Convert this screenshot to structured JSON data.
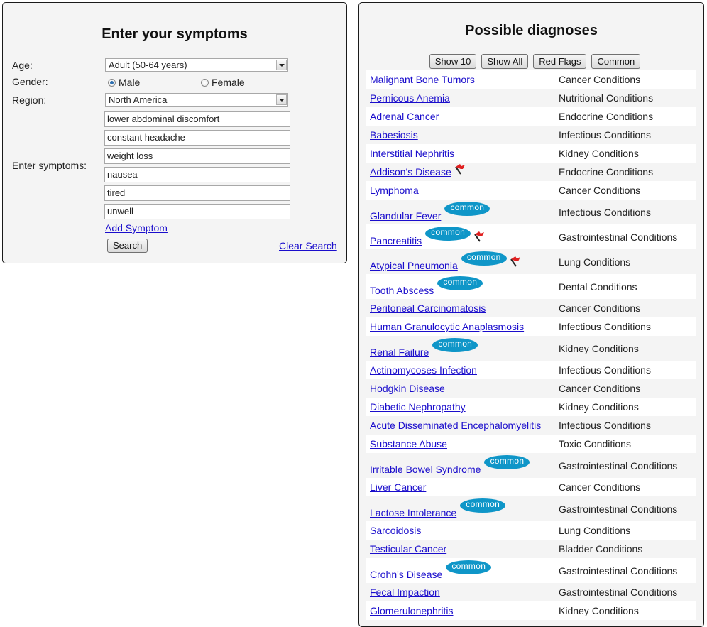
{
  "symptom_form": {
    "title": "Enter your symptoms",
    "age_label": "Age:",
    "age_value": "Adult (50-64 years)",
    "gender_label": "Gender:",
    "gender_options": [
      {
        "label": "Male",
        "selected": true
      },
      {
        "label": "Female",
        "selected": false
      }
    ],
    "region_label": "Region:",
    "region_value": "North America",
    "symptoms_label": "Enter symptoms:",
    "symptoms": [
      "lower abdominal discomfort",
      "constant headache",
      "weight loss",
      "nausea",
      "tired",
      "unwell"
    ],
    "add_symptom_label": "Add Symptom",
    "search_label": "Search",
    "clear_search_label": "Clear Search"
  },
  "diagnoses": {
    "title": "Possible diagnoses",
    "filters": [
      "Show 10",
      "Show All",
      "Red Flags",
      "Common"
    ],
    "badge_text": "common",
    "colors": {
      "link": "#1a0dcc",
      "badge": "#0f96c8",
      "flag": "#e02020"
    },
    "items": [
      {
        "name": "Malignant Bone Tumors",
        "category": "Cancer Conditions",
        "common": false,
        "red_flag": false
      },
      {
        "name": "Pernicous Anemia",
        "category": "Nutritional Conditions",
        "common": false,
        "red_flag": false
      },
      {
        "name": "Adrenal Cancer",
        "category": "Endocrine Conditions",
        "common": false,
        "red_flag": false
      },
      {
        "name": "Babesiosis",
        "category": "Infectious Conditions",
        "common": false,
        "red_flag": false
      },
      {
        "name": "Interstitial Nephritis",
        "category": "Kidney Conditions",
        "common": false,
        "red_flag": false
      },
      {
        "name": "Addison's Disease",
        "category": "Endocrine Conditions",
        "common": false,
        "red_flag": true
      },
      {
        "name": "Lymphoma",
        "category": "Cancer Conditions",
        "common": false,
        "red_flag": false
      },
      {
        "name": "Glandular Fever",
        "category": "Infectious Conditions",
        "common": true,
        "red_flag": false
      },
      {
        "name": "Pancreatitis",
        "category": "Gastrointestinal Conditions",
        "common": true,
        "red_flag": true
      },
      {
        "name": "Atypical Pneumonia",
        "category": "Lung Conditions",
        "common": true,
        "red_flag": true
      },
      {
        "name": "Tooth Abscess",
        "category": "Dental Conditions",
        "common": true,
        "red_flag": false
      },
      {
        "name": "Peritoneal Carcinomatosis",
        "category": "Cancer Conditions",
        "common": false,
        "red_flag": false
      },
      {
        "name": "Human Granulocytic Anaplasmosis",
        "category": "Infectious Conditions",
        "common": false,
        "red_flag": false
      },
      {
        "name": "Renal Failure",
        "category": "Kidney Conditions",
        "common": true,
        "red_flag": false
      },
      {
        "name": "Actinomycoses Infection",
        "category": "Infectious Conditions",
        "common": false,
        "red_flag": false
      },
      {
        "name": "Hodgkin Disease",
        "category": "Cancer Conditions",
        "common": false,
        "red_flag": false
      },
      {
        "name": "Diabetic Nephropathy",
        "category": "Kidney Conditions",
        "common": false,
        "red_flag": false
      },
      {
        "name": "Acute Disseminated Encephalomyelitis",
        "category": "Infectious Conditions",
        "common": false,
        "red_flag": false
      },
      {
        "name": "Substance Abuse",
        "category": "Toxic Conditions",
        "common": false,
        "red_flag": false
      },
      {
        "name": "Irritable Bowel Syndrome",
        "category": "Gastrointestinal Conditions",
        "common": true,
        "red_flag": false
      },
      {
        "name": "Liver Cancer",
        "category": "Cancer Conditions",
        "common": false,
        "red_flag": false
      },
      {
        "name": "Lactose Intolerance",
        "category": "Gastrointestinal Conditions",
        "common": true,
        "red_flag": false
      },
      {
        "name": "Sarcoidosis",
        "category": "Lung Conditions",
        "common": false,
        "red_flag": false
      },
      {
        "name": "Testicular Cancer",
        "category": "Bladder Conditions",
        "common": false,
        "red_flag": false
      },
      {
        "name": "Crohn's Disease",
        "category": "Gastrointestinal Conditions",
        "common": true,
        "red_flag": false
      },
      {
        "name": "Fecal Impaction",
        "category": "Gastrointestinal Conditions",
        "common": false,
        "red_flag": false
      },
      {
        "name": "Glomerulonephritis",
        "category": "Kidney Conditions",
        "common": false,
        "red_flag": false
      }
    ]
  }
}
